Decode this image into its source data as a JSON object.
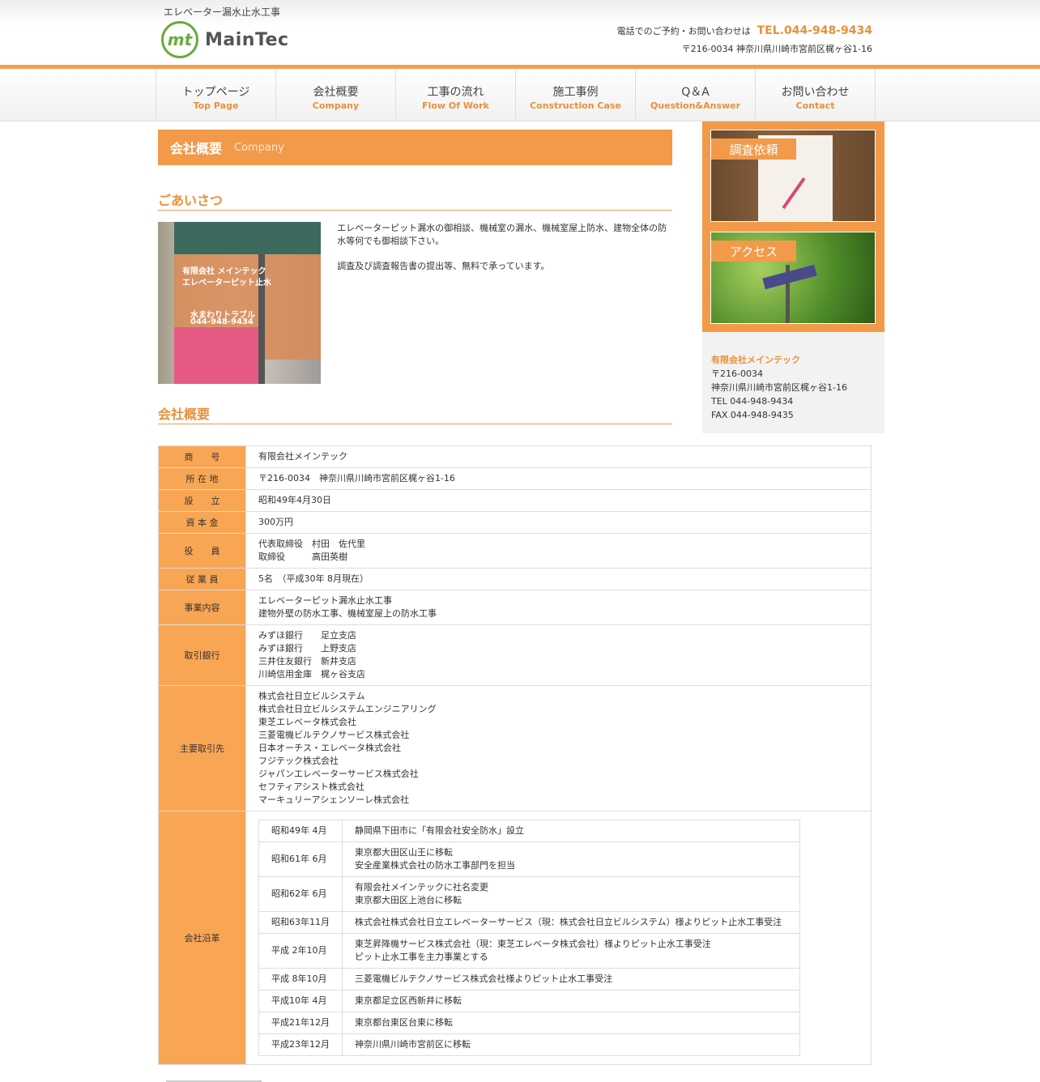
{
  "header": {
    "tagline": "エレベーター漏水止水工事",
    "logo_mark": "mt",
    "logo_name": "MainTec",
    "contact_prefix": "電話でのご予約・お問い合わせは",
    "tel": "TEL.044-948-9434",
    "address": "〒216-0034 神奈川県川崎市宮前区梶ヶ谷1-16"
  },
  "nav": [
    {
      "jp": "トップページ",
      "en": "Top Page"
    },
    {
      "jp": "会社概要",
      "en": "Company"
    },
    {
      "jp": "工事の流れ",
      "en": "Flow Of Work"
    },
    {
      "jp": "施工事例",
      "en": "Construction Case"
    },
    {
      "jp": "Q＆A",
      "en": "Question&Answer"
    },
    {
      "jp": "お問い合わせ",
      "en": "Contact"
    }
  ],
  "page": {
    "title_jp": "会社概要",
    "title_en": "Company"
  },
  "greeting": {
    "heading": "ごあいさつ",
    "photo_sign": [
      "有限会社 メインテック",
      "エレベーターピット止水",
      "水まわりトラブル",
      "044-948-9434"
    ],
    "p1": "エレベーターピット漏水の御相談、機械室の漏水、機械室屋上防水、建物全体の防水等何でも御相談下さい。",
    "p2": "調査及び調査報告書の提出等、無料で承っています。"
  },
  "sidebar": {
    "banner1": "調査依頼",
    "banner2": "アクセス",
    "company": "有限会社メインテック",
    "zip": "〒216-0034",
    "address": "神奈川県川崎市宮前区梶ヶ谷1-16",
    "tel": "TEL 044-948-9434",
    "fax": "FAX 044-948-9435"
  },
  "profile": {
    "heading": "会社概要",
    "rows": {
      "name_label": "商　　号",
      "name": "有限会社メインテック",
      "address_label": "所 在 地",
      "address": "〒216-0034　神奈川県川崎市宮前区梶ヶ谷1-16",
      "founded_label": "設　　立",
      "founded": "昭和49年4月30日",
      "capital_label": "資 本 金",
      "capital": "300万円",
      "officers_label": "役　　員",
      "officer1": "代表取締役　村田　佐代里",
      "officer2": "取締役　　　高田英樹",
      "employees_label": "従 業 員",
      "employees": "5名　（平成30年 8月現在）",
      "business_label": "事業内容",
      "business1": "エレベーターピット漏水止水工事",
      "business2": "建物外壁の防水工事、機械室屋上の防水工事",
      "banks_label": "取引銀行",
      "banks": [
        "みずほ銀行　　足立支店",
        "みずほ銀行　　上野支店",
        "三井住友銀行　新井支店",
        "川崎信用金庫　梶ヶ谷支店"
      ],
      "clients_label": "主要取引先",
      "clients": [
        "株式会社日立ビルシステム",
        "株式会社日立ビルシステムエンジニアリング",
        "東芝エレベータ株式会社",
        "三菱電機ビルテクノサービス株式会社",
        "日本オーチス・エレベータ株式会社",
        "フジテック株式会社",
        "ジャパンエレベーターサービス株式会社",
        "セフティアシスト株式会社",
        "マーキュリーアシェンソーレ株式会社"
      ],
      "history_label": "会社沿革"
    },
    "history": [
      {
        "date": "昭和49年 4月",
        "l1": "静岡県下田市に「有限会社安全防水」設立",
        "l2": ""
      },
      {
        "date": "昭和61年 6月",
        "l1": "東京都大田区山王に移転",
        "l2": "安全産業株式会社の防水工事部門を担当"
      },
      {
        "date": "昭和62年 6月",
        "l1": "有限会社メインテックに社名変更",
        "l2": "東京都大田区上池台に移転"
      },
      {
        "date": "昭和63年11月",
        "l1": "株式会社株式会社日立エレベーターサービス（現：株式会社日立ビルシステム）様よりピット止水工事受注",
        "l2": ""
      },
      {
        "date": "平成 2年10月",
        "l1": "東芝昇降機サービス株式会社（現：東芝エレベータ株式会社）様よりピット止水工事受注",
        "l2": "ピット止水工事を主力事業とする"
      },
      {
        "date": "平成 8年10月",
        "l1": "三菱電機ビルテクノサービス株式会社様よりピット止水工事受注",
        "l2": ""
      },
      {
        "date": "平成10年 4月",
        "l1": "東京都足立区西新井に移転",
        "l2": ""
      },
      {
        "date": "平成21年12月",
        "l1": "東京都台東区台東に移転",
        "l2": ""
      },
      {
        "date": "平成23年12月",
        "l1": "神奈川県川崎市宮前区に移転",
        "l2": ""
      }
    ]
  },
  "colors": {
    "accent": "#f29a4a",
    "logo_green": "#6aab3c",
    "table_header": "#f9a654"
  }
}
